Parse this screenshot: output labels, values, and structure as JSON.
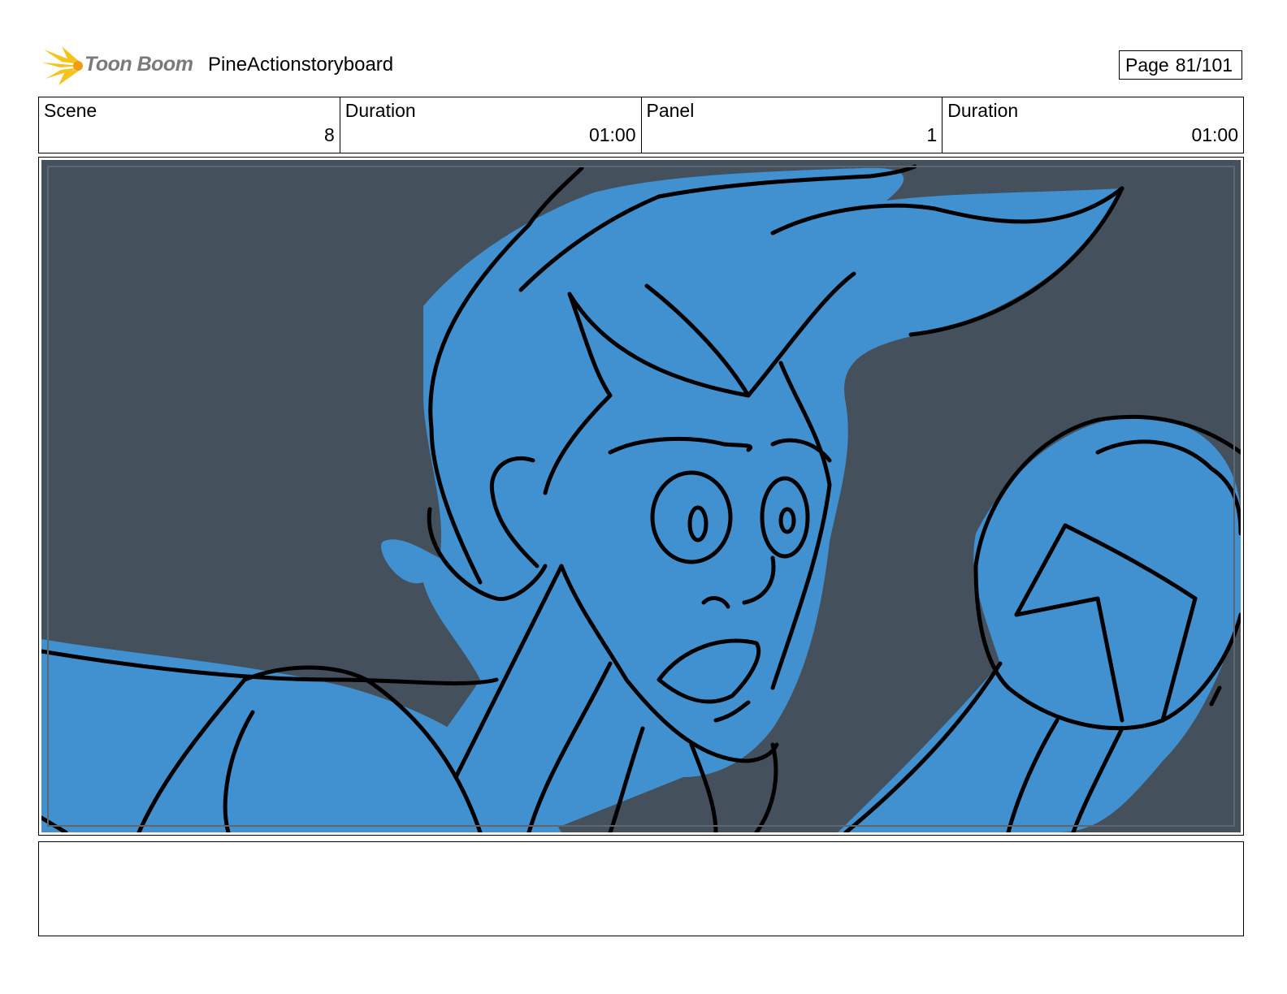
{
  "header": {
    "logo_text": "Toon Boom",
    "project_title": "PineActionstoryboard",
    "page_label": "Page",
    "page_number": "81/101"
  },
  "info": {
    "scene_label": "Scene",
    "scene_value": "8",
    "scene_duration_label": "Duration",
    "scene_duration_value": "01:00",
    "panel_label": "Panel",
    "panel_value": "1",
    "panel_duration_label": "Duration",
    "panel_duration_value": "01:00"
  },
  "panel": {
    "image_icon": "storyboard-drawing-icon",
    "background_color": "#44505c",
    "figure_color": "#4190cf",
    "line_color": "#000000"
  },
  "notes": {
    "text": ""
  }
}
